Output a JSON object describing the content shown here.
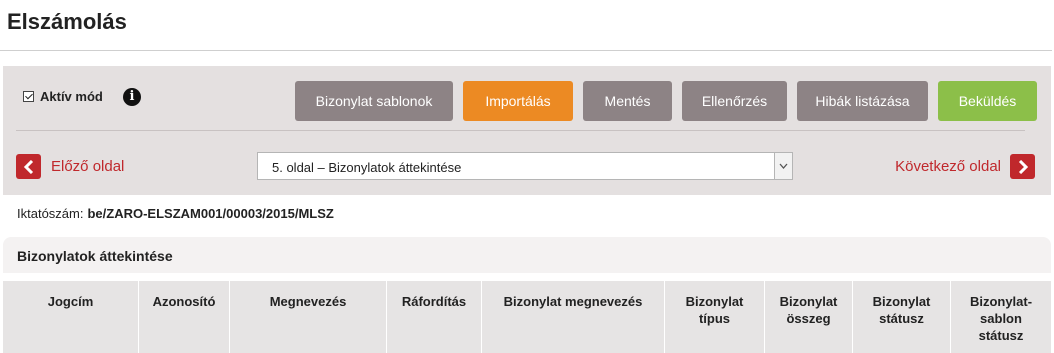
{
  "page": {
    "title": "Elszámolás"
  },
  "toolbar": {
    "active_mode_label": "Aktív mód",
    "active_mode_checked": true,
    "info_icon": "info-icon",
    "buttons": {
      "templates": "Bizonylat sablonok",
      "import": "Importálás",
      "save": "Mentés",
      "check": "Ellenőrzés",
      "list_errors": "Hibák listázása",
      "submit": "Beküldés"
    },
    "colors": {
      "gray": "#8d8385",
      "orange": "#ec8a23",
      "green": "#8cbf49",
      "nav_red": "#c0282c"
    }
  },
  "navigation": {
    "prev_label": "Előző oldal",
    "next_label": "Következő oldal",
    "page_select_value": "5. oldal – Bizonylatok áttekintése",
    "prev_icon": "chevron-left-icon",
    "next_icon": "chevron-right-icon"
  },
  "registration": {
    "label": "Iktatószám:",
    "value": "be/ZARO-ELSZAM001/00003/2015/MLSZ"
  },
  "section": {
    "title": "Bizonylatok áttekintése",
    "columns": {
      "c1": "Jogcím",
      "c2": "Azonosító",
      "c3": "Megnevezés",
      "c4": "Ráfordítás",
      "c5": "Bizonylat megnevezés",
      "c6": [
        "Bizonylat",
        "típus"
      ],
      "c7": [
        "Bizonylat",
        "összeg"
      ],
      "c8": [
        "Bizonylat",
        "státusz"
      ],
      "c9": [
        "Bizonylat-",
        "sablon",
        "státusz"
      ]
    }
  }
}
